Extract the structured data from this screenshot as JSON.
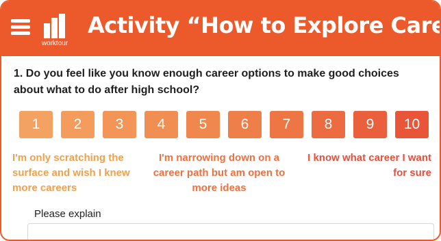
{
  "header": {
    "logo_text": "worktour",
    "title": "Activity “How to Explore Careers”"
  },
  "question": {
    "text": "1. Do you feel like you know enough career options to make good choices about what to do after high school?"
  },
  "scale": {
    "options": [
      {
        "label": "1",
        "color": "#f4a262"
      },
      {
        "label": "2",
        "color": "#f39c5c"
      },
      {
        "label": "3",
        "color": "#f29556"
      },
      {
        "label": "4",
        "color": "#f18e51"
      },
      {
        "label": "5",
        "color": "#f0874c"
      },
      {
        "label": "6",
        "color": "#ef7f48"
      },
      {
        "label": "7",
        "color": "#ed7644"
      },
      {
        "label": "8",
        "color": "#ec6b40"
      },
      {
        "label": "9",
        "color": "#ea603c"
      },
      {
        "label": "10",
        "color": "#e85538"
      }
    ]
  },
  "anchors": {
    "left": "I'm only scratching the surface and wish I knew more careers",
    "middle": "I'm narrowing down on a career path but am open to more ideas",
    "right": "I know what career I want for sure"
  },
  "explain": {
    "label": "Please explain",
    "value": ""
  },
  "colors": {
    "brand": "#ec5a2b"
  }
}
